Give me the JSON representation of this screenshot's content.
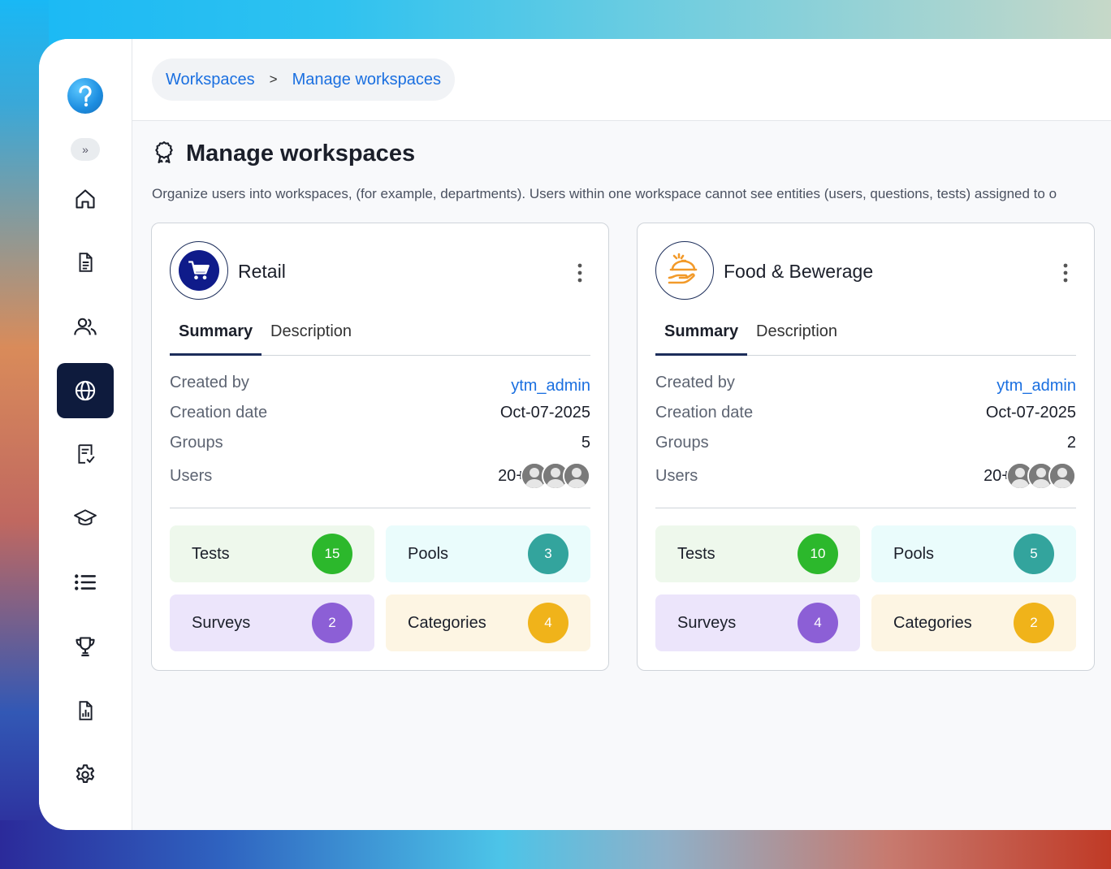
{
  "breadcrumb": {
    "root": "Workspaces",
    "separator": ">",
    "current": "Manage workspaces"
  },
  "page": {
    "title": "Manage workspaces",
    "subtitle": "Organize users into workspaces, (for example, departments). Users within one workspace cannot see entities (users, questions, tests) assigned to o"
  },
  "sidebar": {
    "items": [
      "home-icon",
      "document-icon",
      "users-icon",
      "globe-icon",
      "checklist-icon",
      "graduation-cap-icon",
      "list-icon",
      "trophy-icon",
      "report-icon",
      "settings-icon"
    ],
    "active": "globe-icon"
  },
  "labels": {
    "summary": "Summary",
    "description": "Description",
    "created_by": "Created by",
    "creation_date": "Creation date",
    "groups": "Groups",
    "users": "Users",
    "tests": "Tests",
    "pools": "Pools",
    "surveys": "Surveys",
    "categories": "Categories"
  },
  "workspaces": [
    {
      "name": "Retail",
      "icon": "shopping-cart-icon",
      "created_by": "ytm_admin",
      "creation_date": "Oct-07-2025",
      "groups": "5",
      "users": "20+",
      "tests": "15",
      "pools": "3",
      "surveys": "2",
      "categories": "4"
    },
    {
      "name": "Food & Bewerage",
      "icon": "food-serving-icon",
      "created_by": "ytm_admin",
      "creation_date": "Oct-07-2025",
      "groups": "2",
      "users": "20+",
      "tests": "10",
      "pools": "5",
      "surveys": "4",
      "categories": "2"
    }
  ],
  "colors": {
    "tests_bg": "#eef8ec",
    "tests_badge": "#2cb82c",
    "pools_bg": "#eafcfc",
    "pools_badge": "#33a49d",
    "surveys_bg": "#ece5fb",
    "surveys_badge": "#8c5fd6",
    "categories_bg": "#fdf5e3",
    "categories_badge": "#f0b31a",
    "link": "#1a6fe0",
    "sidebar_active": "#0e1b3d"
  }
}
